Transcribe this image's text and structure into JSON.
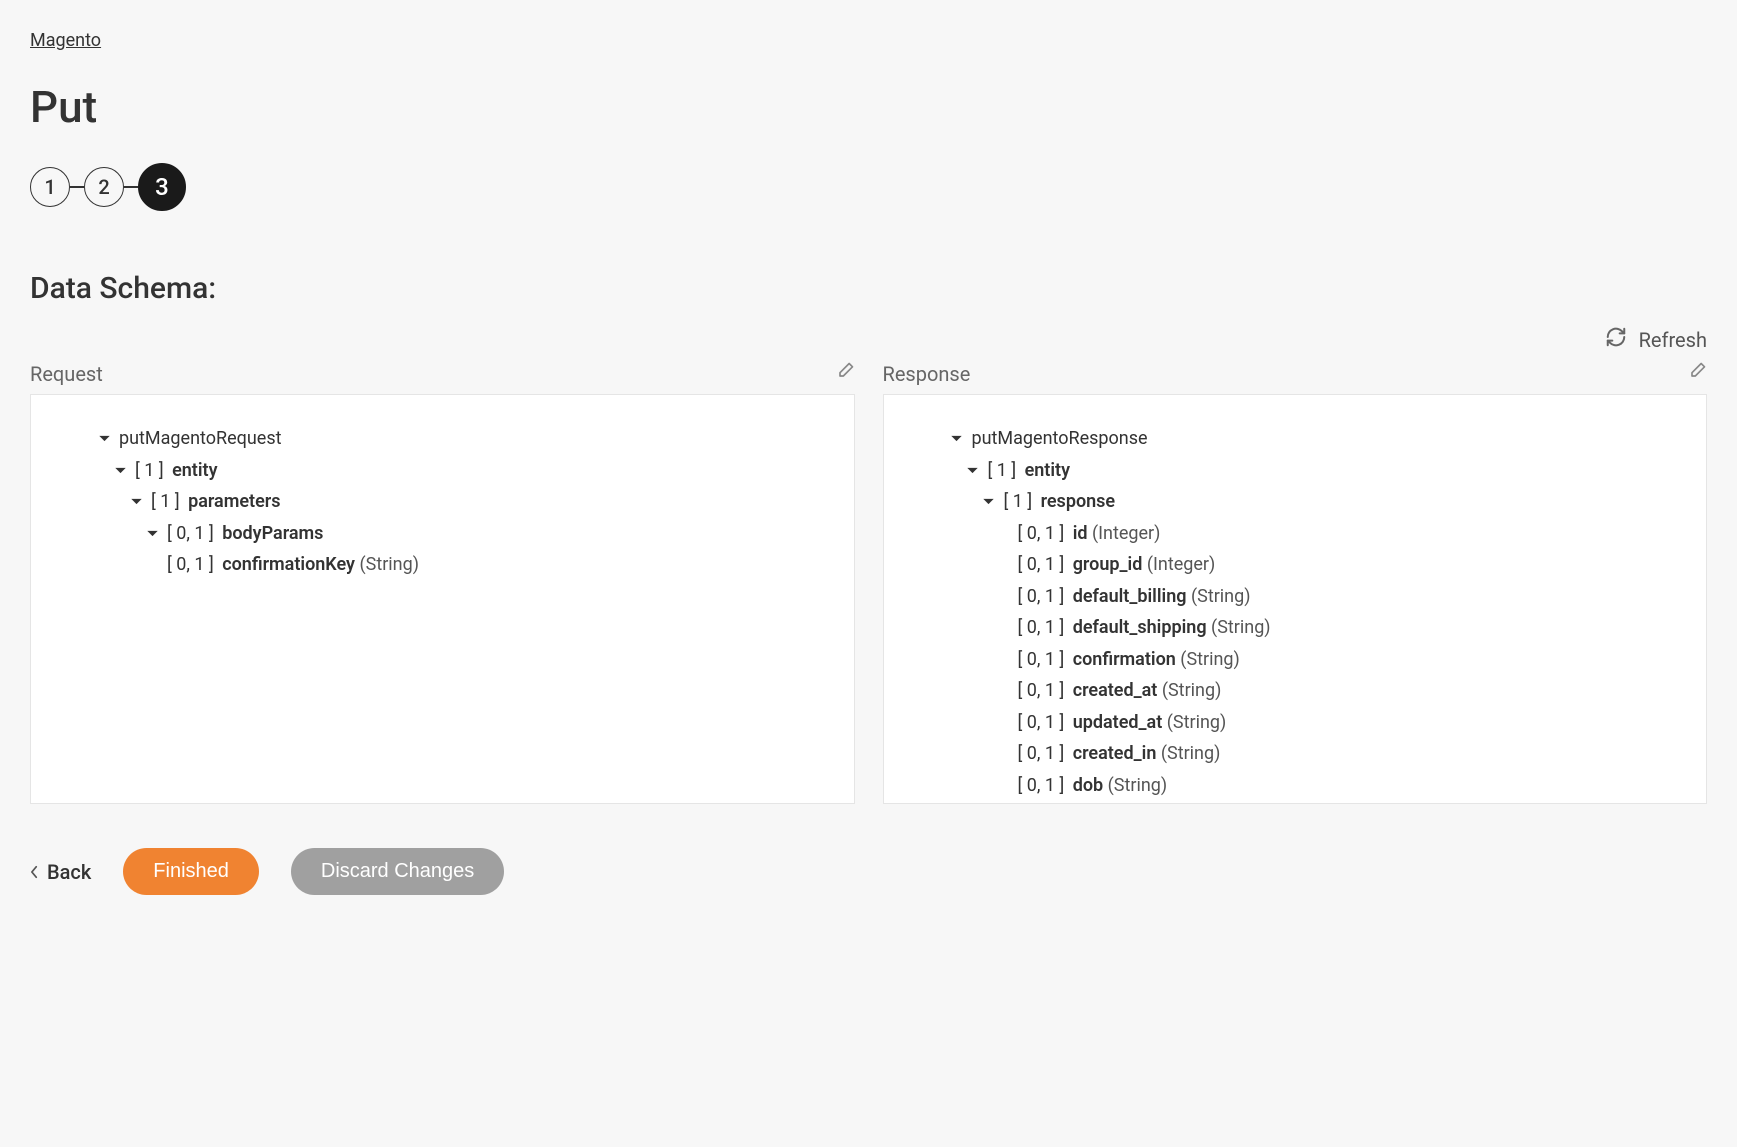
{
  "breadcrumb": "Magento",
  "page_title": "Put",
  "stepper": {
    "s1": "1",
    "s2": "2",
    "s3": "3"
  },
  "section_title": "Data Schema:",
  "refresh_label": "Refresh",
  "panels": {
    "request_label": "Request",
    "response_label": "Response"
  },
  "request_tree": {
    "root": "putMagentoRequest",
    "entity_range": "[ 1 ]",
    "entity_name": "entity",
    "parameters_range": "[ 1 ]",
    "parameters_name": "parameters",
    "bodyParams_range": "[ 0, 1 ]",
    "bodyParams_name": "bodyParams",
    "confirmationKey_range": "[ 0, 1 ]",
    "confirmationKey_name": "confirmationKey",
    "confirmationKey_type": "(String)"
  },
  "response_tree": {
    "root": "putMagentoResponse",
    "entity_range": "[ 1 ]",
    "entity_name": "entity",
    "response_range": "[ 1 ]",
    "response_name": "response",
    "fields": [
      {
        "range": "[ 0, 1 ]",
        "name": "id",
        "type": "(Integer)"
      },
      {
        "range": "[ 0, 1 ]",
        "name": "group_id",
        "type": "(Integer)"
      },
      {
        "range": "[ 0, 1 ]",
        "name": "default_billing",
        "type": "(String)"
      },
      {
        "range": "[ 0, 1 ]",
        "name": "default_shipping",
        "type": "(String)"
      },
      {
        "range": "[ 0, 1 ]",
        "name": "confirmation",
        "type": "(String)"
      },
      {
        "range": "[ 0, 1 ]",
        "name": "created_at",
        "type": "(String)"
      },
      {
        "range": "[ 0, 1 ]",
        "name": "updated_at",
        "type": "(String)"
      },
      {
        "range": "[ 0, 1 ]",
        "name": "created_in",
        "type": "(String)"
      },
      {
        "range": "[ 0, 1 ]",
        "name": "dob",
        "type": "(String)"
      }
    ]
  },
  "footer": {
    "back": "Back",
    "finished": "Finished",
    "discard": "Discard Changes"
  }
}
